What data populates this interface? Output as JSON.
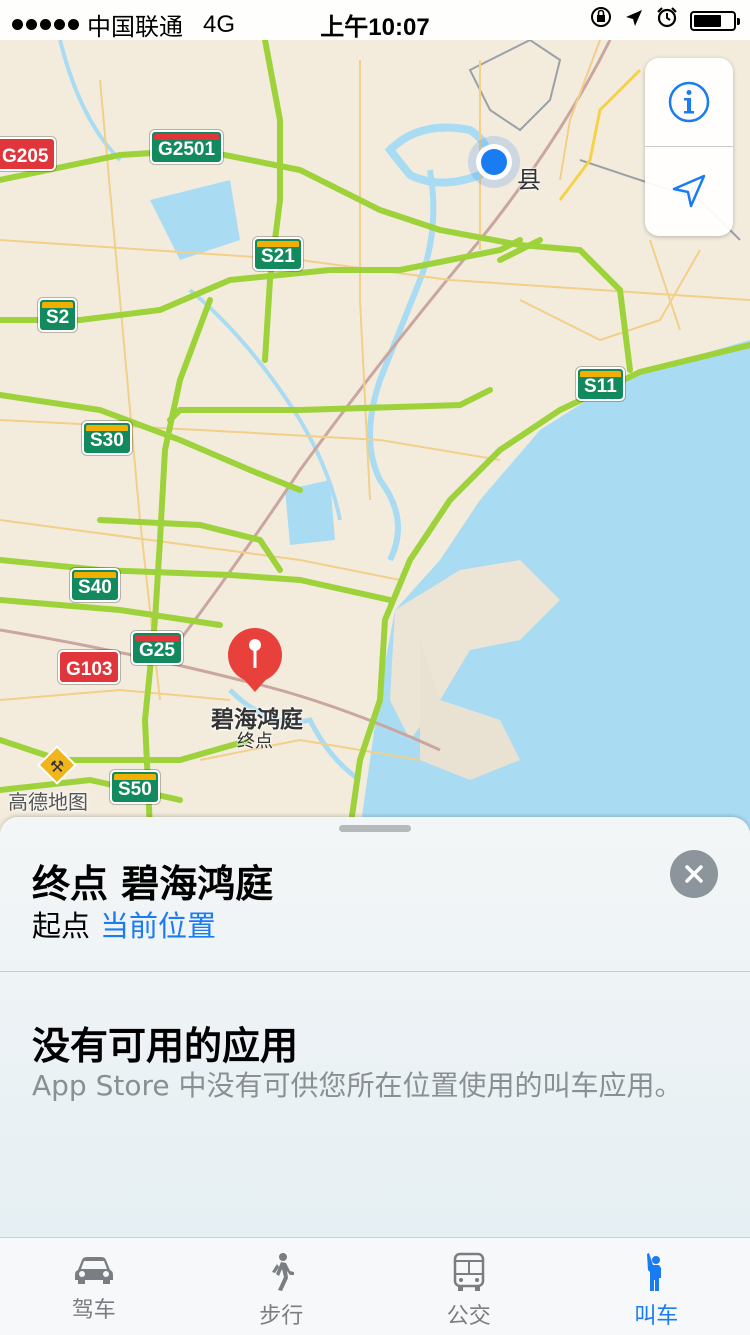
{
  "status_bar": {
    "carrier": "中国联通",
    "network": "4G",
    "time": "上午10:07",
    "battery_level": 0.7
  },
  "map": {
    "road_shields": [
      {
        "label": "G205",
        "style": "red"
      },
      {
        "label": "G2501",
        "style": "redtop"
      },
      {
        "label": "S21",
        "style": "green"
      },
      {
        "label": "S2",
        "style": "green"
      },
      {
        "label": "S11",
        "style": "green"
      },
      {
        "label": "S30",
        "style": "green"
      },
      {
        "label": "S40",
        "style": "green"
      },
      {
        "label": "G25",
        "style": "redtop"
      },
      {
        "label": "G103",
        "style": "red"
      },
      {
        "label": "S50",
        "style": "green"
      }
    ],
    "county_label": "县",
    "destination_pin": {
      "name": "碧海鸿庭",
      "sub": "终点",
      "color": "#e8413c"
    },
    "watermark": "高德地图",
    "colors": {
      "land": "#f3ecdd",
      "water": "#a9dcf2",
      "highway": "#9ed23a",
      "user_location": "#1a7cf3"
    }
  },
  "controls": {
    "info_icon": "info-icon",
    "locate_icon": "location-arrow-icon"
  },
  "panel": {
    "destination_title": "终点 碧海鸿庭",
    "origin_prefix": "起点",
    "origin_value": "当前位置",
    "no_app_title": "没有可用的应用",
    "no_app_desc": "App Store 中没有可供您所在位置使用的叫车应用。"
  },
  "tabs": [
    {
      "label": "驾车",
      "icon": "car-icon",
      "active": false
    },
    {
      "label": "步行",
      "icon": "walk-icon",
      "active": false
    },
    {
      "label": "公交",
      "icon": "bus-icon",
      "active": false
    },
    {
      "label": "叫车",
      "icon": "hail-icon",
      "active": true
    }
  ],
  "accent_color": "#1a7cf3"
}
